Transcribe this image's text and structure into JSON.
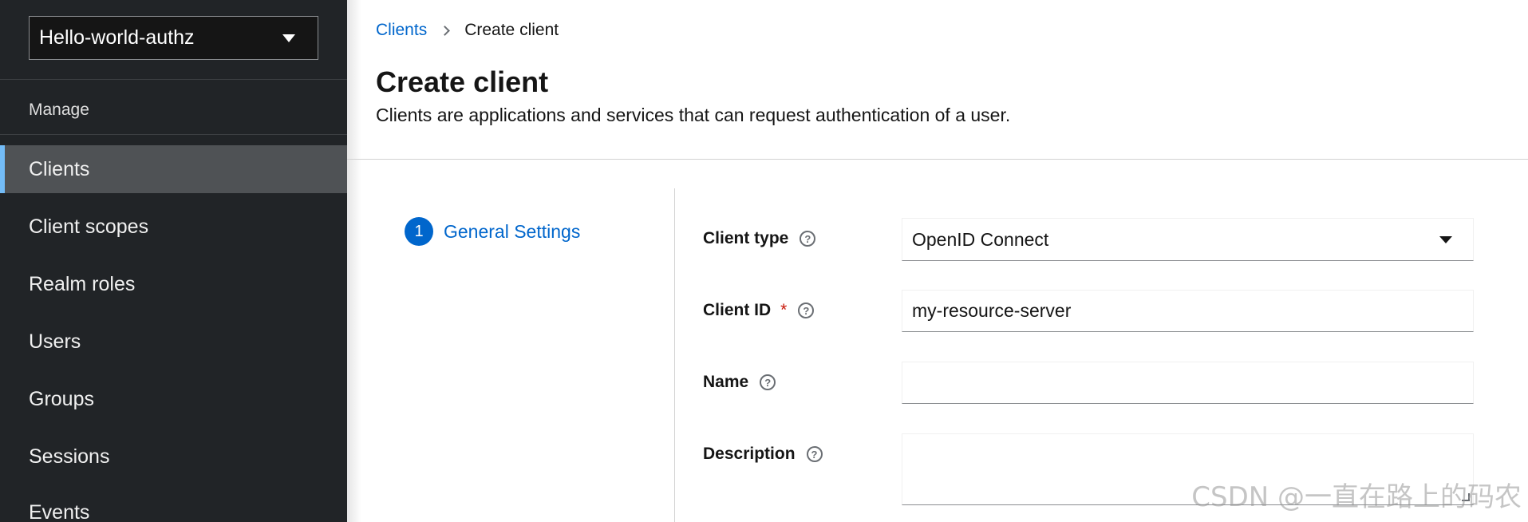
{
  "sidebar": {
    "realm": "Hello-world-authz",
    "section": "Manage",
    "items": [
      {
        "label": "Clients",
        "active": true
      },
      {
        "label": "Client scopes"
      },
      {
        "label": "Realm roles"
      },
      {
        "label": "Users"
      },
      {
        "label": "Groups"
      },
      {
        "label": "Sessions"
      },
      {
        "label": "Events"
      }
    ]
  },
  "breadcrumb": {
    "link": "Clients",
    "current": "Create client"
  },
  "header": {
    "title": "Create client",
    "description": "Clients are applications and services that can request authentication of a user."
  },
  "wizard": {
    "step_number": "1",
    "step_label": "General Settings"
  },
  "form": {
    "client_type": {
      "label": "Client type",
      "value": "OpenID Connect"
    },
    "client_id": {
      "label": "Client ID",
      "required_marker": "*",
      "value": "my-resource-server"
    },
    "name": {
      "label": "Name",
      "value": ""
    },
    "description": {
      "label": "Description",
      "value": ""
    }
  },
  "watermark": "CSDN @一直在路上的码农",
  "colors": {
    "sidebar_bg": "#212427",
    "active_bg": "#4f5255",
    "accent": "#0066cc",
    "active_marker": "#73bcf7",
    "required": "#c9190b"
  }
}
